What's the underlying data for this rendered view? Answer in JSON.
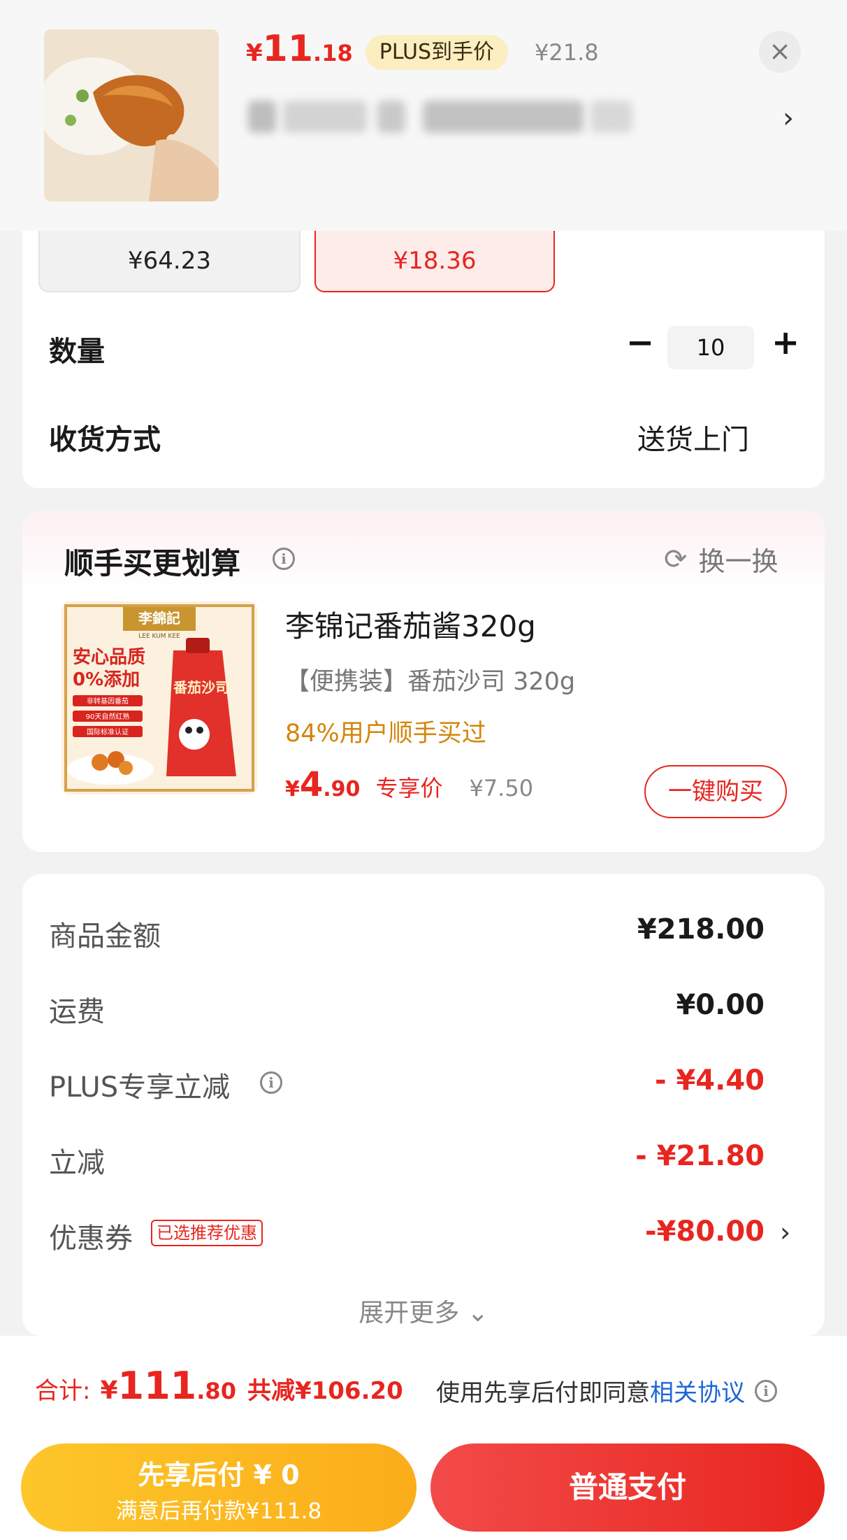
{
  "header": {
    "price_symbol": "¥",
    "price_int": "11",
    "price_dec": ".18",
    "plus_label": "PLUS到手价",
    "original_price": "¥21.8",
    "close_icon": "close-icon",
    "chevron_icon": "chevron-right-icon"
  },
  "specs": {
    "option_a_price": "¥64.23",
    "option_b_price": "¥18.36"
  },
  "quantity": {
    "label": "数量",
    "minus": "−",
    "value": "10",
    "plus": "+"
  },
  "delivery": {
    "label": "收货方式",
    "value": "送货上门"
  },
  "upsell": {
    "title": "顺手买更划算",
    "refresh_label": "换一换",
    "product": {
      "name": "李锦记番茄酱320g",
      "desc": "【便携装】番茄沙司 320g",
      "social": "84%用户顺手买过",
      "price_symbol": "¥",
      "price_int": "4",
      "price_dec": ".90",
      "price_tag": "专享价",
      "original_price": "¥7.50",
      "buy_label": "一键购买",
      "image_texts": {
        "brand": "李錦記",
        "brand_en": "LEE KUM KEE",
        "line1": "安心品质",
        "line2": "0%添加",
        "badge1": "非转基因番茄",
        "badge2": "90天自然红熟",
        "badge3": "国际标准认证",
        "pack": "番茄沙司"
      }
    }
  },
  "summary": {
    "rows": [
      {
        "label": "商品金额",
        "value": "¥218.00"
      },
      {
        "label": "运费",
        "value": "¥0.00"
      },
      {
        "label": "PLUS专享立减",
        "value": "- ¥4.40"
      },
      {
        "label": "立减",
        "value": "- ¥21.80"
      },
      {
        "label": "优惠券",
        "value": "-¥80.00"
      }
    ],
    "coupon_tag": "已选推荐优惠",
    "expand_label": "展开更多 ⌄"
  },
  "footer": {
    "total_label": "合计:",
    "total_symbol": "¥",
    "total_int": "111",
    "total_dec": ".80",
    "total_save": "共减¥106.20",
    "agree_text": "使用先享后付即同意",
    "agree_link": "相关协议",
    "later_pay_title": "先享后付 ¥ 0",
    "later_pay_sub": "满意后再付款¥111.8",
    "pay_label": "普通支付"
  },
  "colors": {
    "accent_red": "#e8251f",
    "plus_gold": "#fbeec0",
    "orange_btn": "#fdc62a",
    "link_blue": "#1e66d6"
  }
}
